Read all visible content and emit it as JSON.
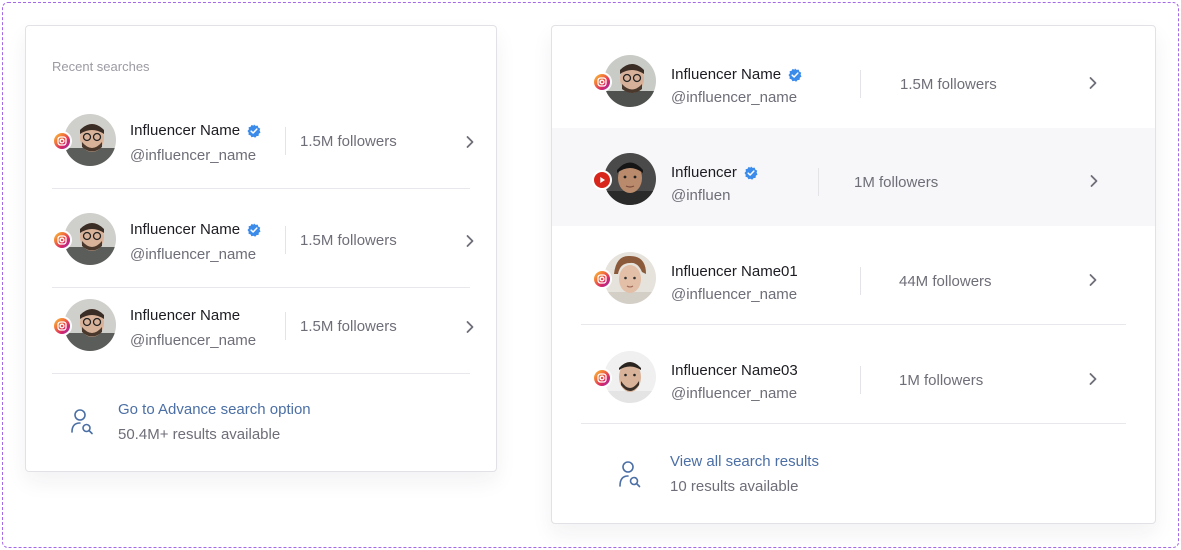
{
  "left": {
    "section_title": "Recent searches",
    "rows": [
      {
        "name": "Influencer Name",
        "verified": true,
        "handle": "@influencer_name",
        "followers": "1.5M followers",
        "platform": "instagram-icon"
      },
      {
        "name": "Influencer Name",
        "verified": true,
        "handle": "@influencer_name",
        "followers": "1.5M followers",
        "platform": "instagram-icon"
      },
      {
        "name": "Influencer Name",
        "verified": false,
        "handle": "@influencer_name",
        "followers": "1.5M followers",
        "platform": "instagram-icon"
      }
    ],
    "footer": {
      "link": "Go to Advance search option",
      "sub": "50.4M+ results available"
    }
  },
  "right": {
    "rows": [
      {
        "name": "Influencer Name",
        "verified": true,
        "handle": "@influencer_name",
        "followers": "1.5M followers",
        "platform": "instagram-icon",
        "highlighted": false
      },
      {
        "name": "Influencer",
        "verified": true,
        "handle": "@influen",
        "followers": "1M followers",
        "platform": "youtube-icon",
        "highlighted": true
      },
      {
        "name": "Influencer Name01",
        "verified": false,
        "handle": "@influencer_name",
        "followers": "44M followers",
        "platform": "instagram-icon",
        "highlighted": false
      },
      {
        "name": "Influencer Name03",
        "verified": false,
        "handle": "@influencer_name",
        "followers": "1M followers",
        "platform": "instagram-icon",
        "highlighted": false
      }
    ],
    "footer": {
      "link": "View all search results",
      "sub": "10 results available"
    }
  },
  "colors": {
    "frame_border": "#a468e8",
    "link": "#4b6fa5",
    "verified": "#3b8beb",
    "instagram_gradient_start": "#f9c83c",
    "instagram_gradient_end": "#8a3ab9",
    "youtube": "#d8261c",
    "highlight_row": "#f7f7f9"
  }
}
